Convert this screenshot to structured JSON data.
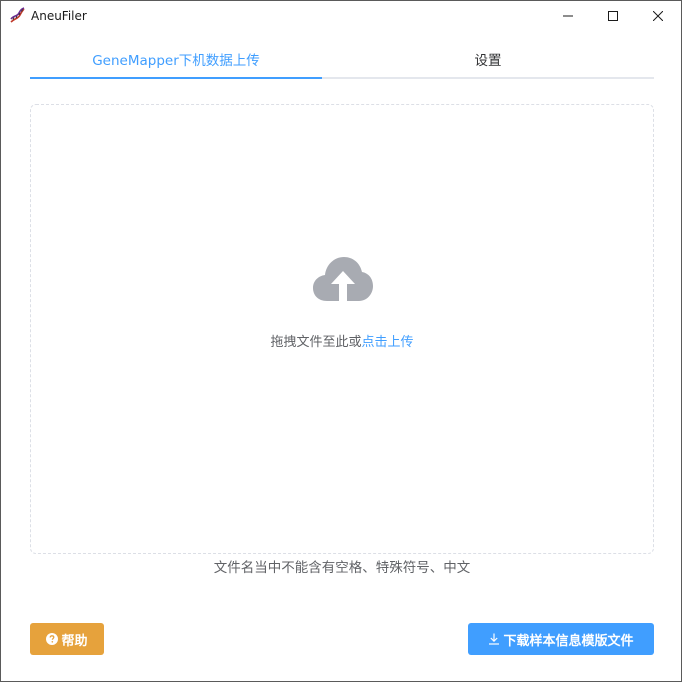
{
  "window": {
    "title": "AneuFiler",
    "app_icon": "dna-icon",
    "controls": {
      "minimize": "minimize-icon",
      "maximize": "maximize-icon",
      "close": "close-icon"
    }
  },
  "tabs": [
    {
      "label": "GeneMapper下机数据上传",
      "active": true
    },
    {
      "label": "设置",
      "active": false
    }
  ],
  "upload": {
    "icon": "cloud-upload-icon",
    "prompt": "拖拽文件至此或",
    "link": "点击上传"
  },
  "tip": "文件名当中不能含有空格、特殊符号、中文",
  "buttons": {
    "help": {
      "icon": "question-circle-icon",
      "label": "帮助"
    },
    "download": {
      "icon": "download-icon",
      "label": "下载样本信息模版文件"
    }
  },
  "colors": {
    "primary": "#409eff",
    "warning": "#e6a23c",
    "icon_gray": "#a8abb2",
    "text": "#606266"
  }
}
